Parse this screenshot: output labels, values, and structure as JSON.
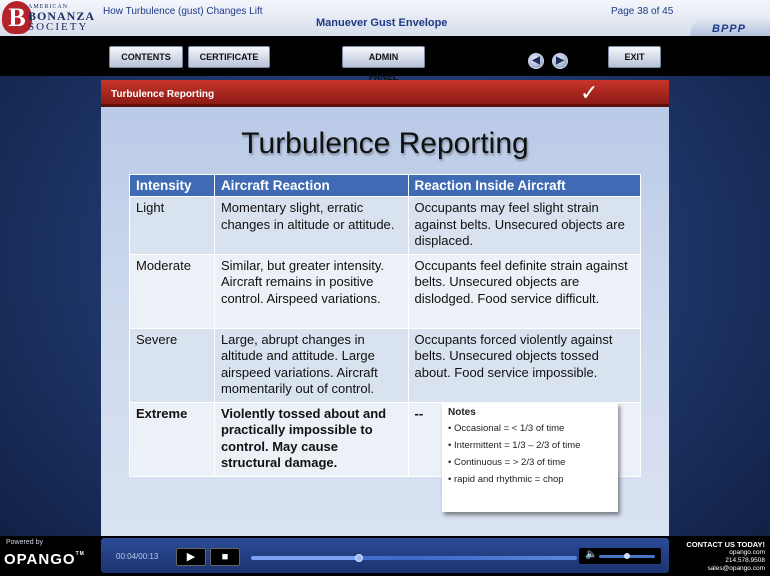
{
  "header": {
    "logo": {
      "line1": "AMERICAN",
      "line2": "BONANZA",
      "line3": "SOCIETY"
    },
    "lesson_title": "How Turbulence (gust) Changes Lift",
    "course_title": "Manuever Gust Envelope",
    "page_indicator": "Page 38 of 45",
    "program_logo": "BPPP"
  },
  "nav": {
    "contents": "CONTENTS",
    "certificate": "CERTIFICATE",
    "admin_panel": "ADMIN PANEL",
    "prev_icon": "arrow-left-icon",
    "next_icon": "arrow-right-icon",
    "exit": "EXIT"
  },
  "slide": {
    "bar_title": "Turbulence Reporting",
    "check_icon": "checkmark-icon",
    "title": "Turbulence Reporting",
    "table": {
      "headers": [
        "Intensity",
        "Aircraft Reaction",
        "Reaction Inside Aircraft"
      ],
      "rows": [
        [
          "Light",
          "Momentary slight, erratic changes in altitude or attitude.",
          "Occupants may feel slight strain against belts.  Unsecured objects are displaced."
        ],
        [
          "Moderate",
          "Similar, but greater intensity. Aircraft remains in positive control. Airspeed variations.",
          "Occupants feel definite strain against belts.  Unsecured objects are dislodged.  Food service difficult."
        ],
        [
          "Severe",
          "Large, abrupt changes in altitude and attitude. Large airspeed variations. Aircraft momentarily out of control.",
          "Occupants forced violently against belts. Unsecured objects tossed about. Food service impossible."
        ],
        [
          "Extreme",
          "Violently tossed about and practically impossible to control.  May cause structural damage.",
          "--"
        ]
      ]
    },
    "notes": {
      "title": "Notes",
      "items": [
        "• Occasional = < 1/3 of time",
        "• Intermittent = 1/3 – 2/3 of time",
        "• Continuous = > 2/3 of time",
        "• rapid and rhythmic = chop"
      ]
    }
  },
  "footer": {
    "powered_by": "Powered by",
    "brand": "OPANGO",
    "trademark": "TM",
    "time": "00:04/00:13",
    "play_icon": "play-icon",
    "stop_icon": "stop-icon",
    "progress": 0.33,
    "volume_icon": "speaker-icon",
    "volume": 0.5,
    "contact": {
      "title": "CONTACT US TODAY!",
      "site": "opango.com",
      "phone": "214.578.9508",
      "email": "sales@opango.com"
    }
  }
}
